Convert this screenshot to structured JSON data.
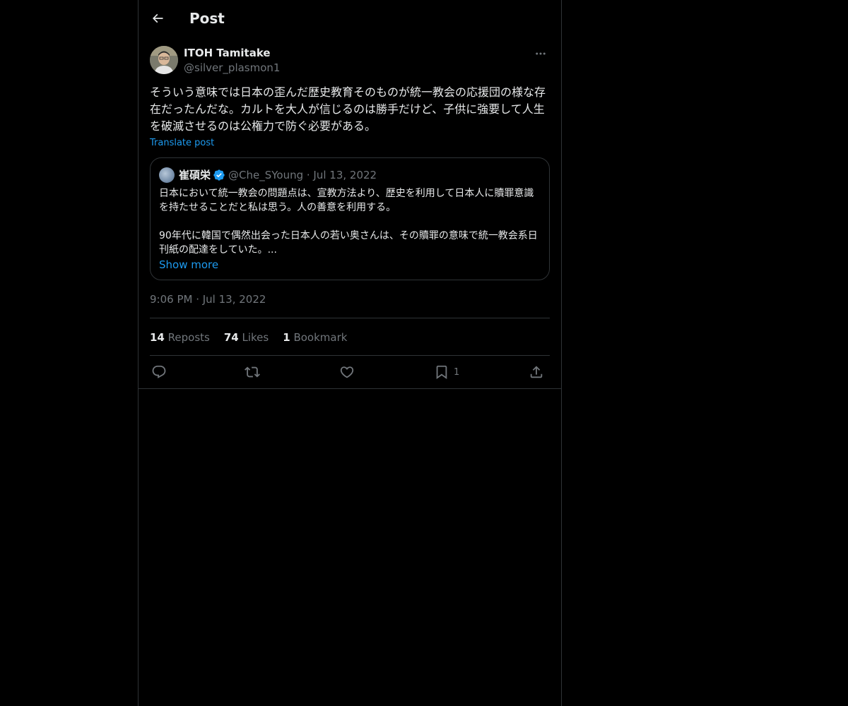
{
  "header": {
    "title": "Post"
  },
  "post": {
    "author": {
      "name": "ITOH Tamitake",
      "handle": "@silver_plasmon1"
    },
    "text": "そういう意味では日本の歪んだ歴史教育そのものが統一教会の応援団の様な存在だったんだな。カルトを大人が信じるのは勝手だけど、子供に強要して人生を破滅させるのは公権力で防ぐ必要がある。",
    "translate_label": "Translate post",
    "timestamp": "9:06 PM · Jul 13, 2022"
  },
  "quote": {
    "name": "崔碩栄",
    "handle_date": "@Che_SYoung · Jul 13, 2022",
    "text": "日本において統一教会の問題点は、宣教方法より、歴史を利用して日本人に贖罪意識を持たせることだと私は思う。人の善意を利用する。\n\n90年代に韓国で偶然出会った日本人の若い奥さんは、その贖罪の意味で統一教会系日刊紙の配達をしていた。...",
    "show_more": "Show more"
  },
  "stats": {
    "reposts_count": "14",
    "reposts_label": "Reposts",
    "likes_count": "74",
    "likes_label": "Likes",
    "bookmarks_count": "1",
    "bookmarks_label": "Bookmark"
  },
  "actions": {
    "bookmark_count": "1"
  },
  "colors": {
    "background": "#000000",
    "text": "#e7e9ea",
    "muted": "#71767b",
    "accent": "#1d9bf0",
    "border": "#2f3336"
  },
  "icons": [
    "arrow-left-icon",
    "more-horizontal-icon",
    "verified-badge-icon",
    "reply-icon",
    "repost-icon",
    "like-icon",
    "bookmark-icon",
    "share-icon"
  ]
}
